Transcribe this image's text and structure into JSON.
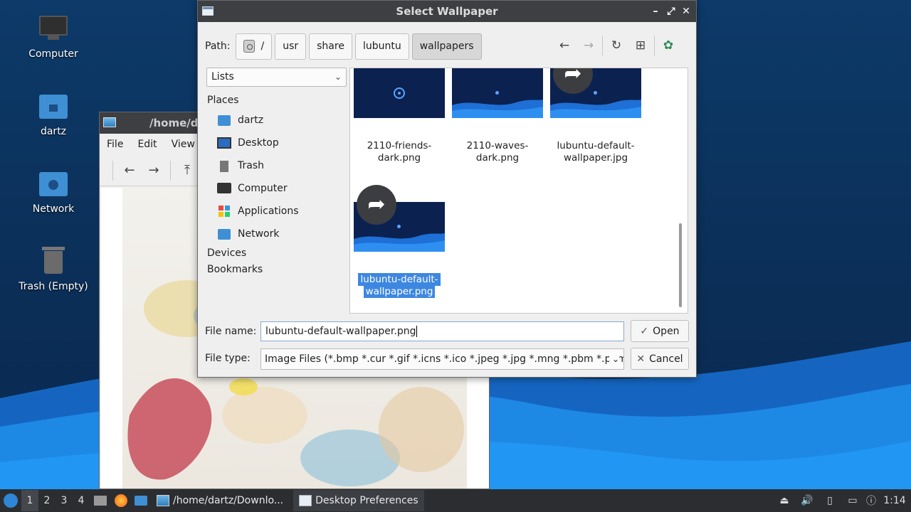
{
  "desktop": {
    "icons": [
      {
        "label": "Computer",
        "icon": "computer-icon"
      },
      {
        "label": "dartz",
        "icon": "home-folder-icon"
      },
      {
        "label": "Network",
        "icon": "network-folder-icon"
      },
      {
        "label": "Trash (Empty)",
        "icon": "trash-icon"
      }
    ]
  },
  "viewer": {
    "title": "/home/d",
    "menu": [
      "File",
      "Edit",
      "View"
    ]
  },
  "dialog": {
    "title": "Select Wallpaper",
    "path_label": "Path:",
    "breadcrumbs": [
      "/",
      "usr",
      "share",
      "lubuntu",
      "wallpapers"
    ],
    "view_mode": "Lists",
    "places_header": "Places",
    "places": [
      {
        "label": "dartz",
        "icon": "home-folder-icon"
      },
      {
        "label": "Desktop",
        "icon": "desktop-icon"
      },
      {
        "label": "Trash",
        "icon": "trash-icon"
      },
      {
        "label": "Computer",
        "icon": "computer-icon"
      },
      {
        "label": "Applications",
        "icon": "applications-icon"
      },
      {
        "label": "Network",
        "icon": "network-folder-icon"
      }
    ],
    "devices_header": "Devices",
    "bookmarks_header": "Bookmarks",
    "files": [
      {
        "name_line1": "2110-friends-",
        "name_line2": "dark.png",
        "link": false
      },
      {
        "name_line1": "2110-waves-",
        "name_line2": "dark.png",
        "link": false
      },
      {
        "name_line1": "lubuntu-default-",
        "name_line2": "wallpaper.jpg",
        "link": true
      },
      {
        "name_line1": "lubuntu-default-",
        "name_line2": "wallpaper.png",
        "link": true,
        "selected": true
      }
    ],
    "file_name_label": "File name:",
    "file_name_value": "lubuntu-default-wallpaper.png",
    "file_type_label": "File type:",
    "file_type_value": "Image Files (*.bmp *.cur *.gif *.icns *.ico *.jpeg *.jpg *.mng *.pbm *.pgm",
    "open_label": "Open",
    "cancel_label": "Cancel"
  },
  "taskbar": {
    "workspaces": [
      "1",
      "2",
      "3",
      "4"
    ],
    "active_workspace": "1",
    "tasks": [
      {
        "label": "/home/dartz/Downlo...",
        "icon": "image-viewer-icon"
      },
      {
        "label": "Desktop Preferences",
        "icon": "window-icon"
      }
    ],
    "clock": "1:14"
  },
  "colors": {
    "desktop_dark": "#0b2f58",
    "wave_light": "#1e88e5",
    "titlebar": "#3d3f43",
    "selection": "#3d87e0",
    "taskbar": "#2b2d31"
  }
}
